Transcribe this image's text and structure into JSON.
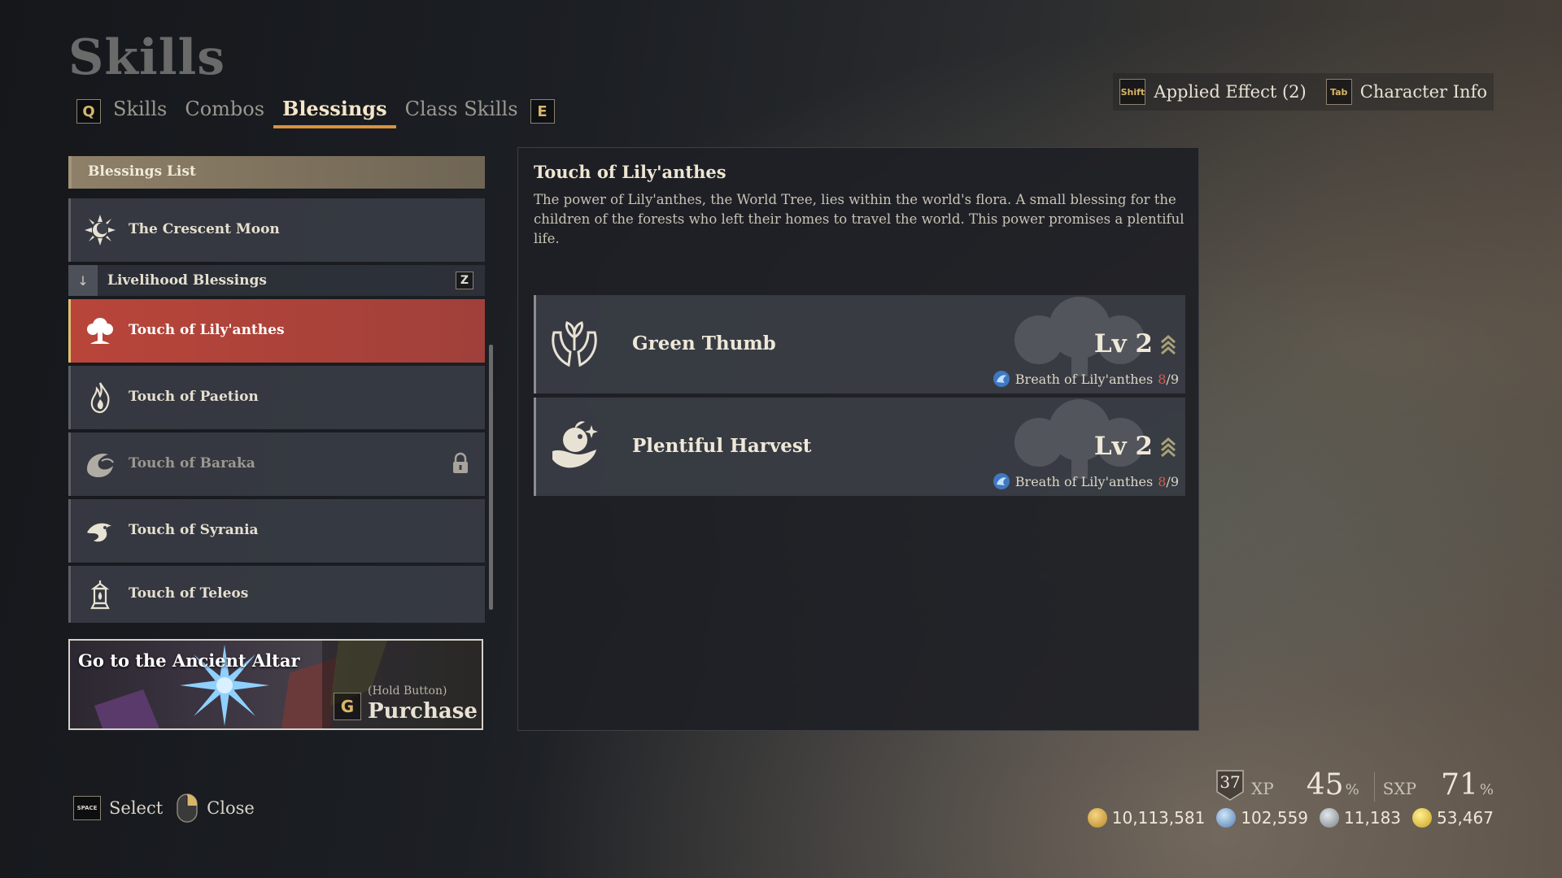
{
  "page": {
    "title": "Skills"
  },
  "tabs": {
    "left_key": "Q",
    "right_key": "E",
    "items": [
      {
        "label": "Skills",
        "active": false
      },
      {
        "label": "Combos",
        "active": false
      },
      {
        "label": "Blessings",
        "active": true
      },
      {
        "label": "Class Skills",
        "active": false
      }
    ]
  },
  "top_right": {
    "applied_effect_key": "Shift",
    "applied_effect_label": "Applied Effect (2)",
    "character_info_key": "Tab",
    "character_info_label": "Character Info"
  },
  "blessings_list": {
    "header": "Blessings List",
    "crescent": {
      "label": "The Crescent Moon",
      "icon": "crescent-moon-icon"
    },
    "group": {
      "label": "Livelihood Blessings",
      "key": "Z"
    },
    "items": [
      {
        "label": "Touch of Lily'anthes",
        "icon": "tree-icon",
        "selected": true,
        "locked": false
      },
      {
        "label": "Touch of Paetion",
        "icon": "flame-icon",
        "selected": false,
        "locked": false
      },
      {
        "label": "Touch of Baraka",
        "icon": "wave-icon",
        "selected": false,
        "locked": true
      },
      {
        "label": "Touch of Syrania",
        "icon": "bird-icon",
        "selected": false,
        "locked": false
      },
      {
        "label": "Touch of Teleos",
        "icon": "lantern-icon",
        "selected": false,
        "locked": false
      }
    ]
  },
  "altar": {
    "title": "Go to the Ancient Altar",
    "key": "G",
    "hold_hint": "(Hold Button)",
    "action": "Purchase"
  },
  "detail": {
    "title": "Touch of Lily'anthes",
    "description": "The power of Lily'anthes, the World Tree, lies within the world's flora. A small blessing for the children of the forests who left their homes to travel the world. This power promises a plentiful life.",
    "skills": [
      {
        "name": "Green Thumb",
        "level": "Lv 2",
        "resource": "Breath of Lily'anthes",
        "current": "8",
        "max": "/9",
        "icon": "sprout-hands-icon"
      },
      {
        "name": "Plentiful Harvest",
        "level": "Lv 2",
        "resource": "Breath of Lily'anthes",
        "current": "8",
        "max": "/9",
        "icon": "harvest-hand-icon"
      }
    ]
  },
  "controls": {
    "select_key": "SPACE",
    "select_label": "Select",
    "close_label": "Close"
  },
  "stats": {
    "level": "37",
    "xp_label": "XP",
    "xp_value": "45",
    "sxp_label": "SXP",
    "sxp_value": "71",
    "percent": "%",
    "currencies": [
      {
        "value": "10,113,581",
        "color": "#d4a640"
      },
      {
        "value": "102,559",
        "color": "#6f9ec8"
      },
      {
        "value": "11,183",
        "color": "#9aa0a8"
      },
      {
        "value": "53,467",
        "color": "#e0c040"
      }
    ]
  }
}
